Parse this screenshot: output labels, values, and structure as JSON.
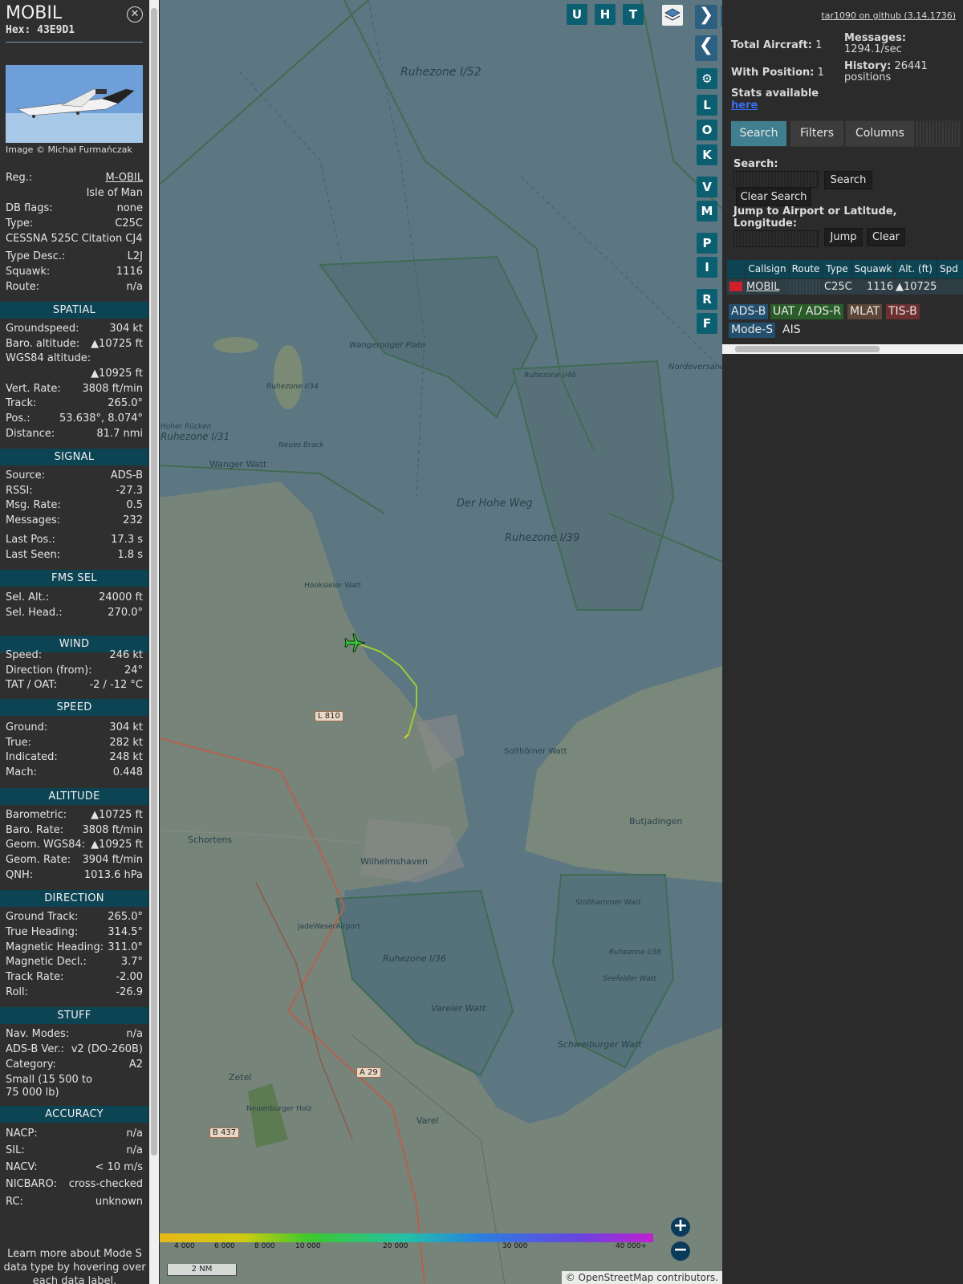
{
  "aircraft": {
    "callsign": "MOBIL",
    "hex_label": "Hex:",
    "hex": "43E9D1",
    "image_credit": "Image © Michał Furmańczak"
  },
  "info_rows": [
    {
      "k": "Reg.:",
      "v": "M-OBIL"
    },
    {
      "k": "",
      "v": "Isle of Man"
    },
    {
      "k": "DB flags:",
      "v": "none"
    },
    {
      "k": "Type:",
      "v": "C25C"
    },
    {
      "k": "CESSNA 525C Citation CJ4",
      "v": ""
    },
    {
      "k": "Type Desc.:",
      "v": "L2J"
    },
    {
      "k": "Squawk:",
      "v": "1116"
    },
    {
      "k": "Route:",
      "v": "n/a"
    }
  ],
  "sections": {
    "spatial": {
      "title": "SPATIAL",
      "rows": [
        {
          "k": "Groundspeed:",
          "v": "304 kt"
        },
        {
          "k": "Baro. altitude:",
          "v": "▲10725 ft"
        },
        {
          "k": "WGS84 altitude:",
          "v": ""
        },
        {
          "k": "",
          "v": "▲10925 ft"
        },
        {
          "k": "Vert. Rate:",
          "v": "3808 ft/min"
        },
        {
          "k": "Track:",
          "v": "265.0°"
        },
        {
          "k": "Pos.:",
          "v": "53.638°, 8.074°"
        },
        {
          "k": "Distance:",
          "v": "81.7 nmi"
        }
      ]
    },
    "signal": {
      "title": "SIGNAL",
      "rows": [
        {
          "k": "Source:",
          "v": "ADS-B"
        },
        {
          "k": "RSSI:",
          "v": "-27.3"
        },
        {
          "k": "Msg. Rate:",
          "v": "0.5"
        },
        {
          "k": "Messages:",
          "v": "232"
        },
        {
          "k": "Last Pos.:",
          "v": "17.3 s"
        },
        {
          "k": "Last Seen:",
          "v": "1.8 s"
        }
      ]
    },
    "fms": {
      "title": "FMS SEL",
      "rows": [
        {
          "k": "Sel. Alt.:",
          "v": "24000 ft"
        },
        {
          "k": "Sel. Head.:",
          "v": "270.0°"
        }
      ]
    },
    "wind": {
      "title": "WIND",
      "rows": [
        {
          "k": "Speed:",
          "v": "246 kt"
        },
        {
          "k": "Direction (from):",
          "v": "24°"
        },
        {
          "k": "TAT / OAT:",
          "v": "-2 / -12 °C"
        }
      ]
    },
    "speed": {
      "title": "SPEED",
      "rows": [
        {
          "k": "Ground:",
          "v": "304 kt"
        },
        {
          "k": "True:",
          "v": "282 kt"
        },
        {
          "k": "Indicated:",
          "v": "248 kt"
        },
        {
          "k": "Mach:",
          "v": "0.448"
        }
      ]
    },
    "altitude": {
      "title": "ALTITUDE",
      "rows": [
        {
          "k": "Barometric:",
          "v": "▲10725 ft"
        },
        {
          "k": "Baro. Rate:",
          "v": "3808 ft/min"
        },
        {
          "k": "Geom. WGS84:",
          "v": "▲10925 ft"
        },
        {
          "k": "Geom. Rate:",
          "v": "3904 ft/min"
        },
        {
          "k": "QNH:",
          "v": "1013.6 hPa"
        }
      ]
    },
    "direction": {
      "title": "DIRECTION",
      "rows": [
        {
          "k": "Ground Track:",
          "v": "265.0°"
        },
        {
          "k": "True Heading:",
          "v": "314.5°"
        },
        {
          "k": "Magnetic Heading:",
          "v": "311.0°"
        },
        {
          "k": "Magnetic Decl.:",
          "v": "3.7°"
        },
        {
          "k": "Track Rate:",
          "v": "-2.00"
        },
        {
          "k": "Roll:",
          "v": "-26.9"
        }
      ]
    },
    "stuff": {
      "title": "STUFF",
      "rows": [
        {
          "k": "Nav. Modes:",
          "v": "n/a"
        },
        {
          "k": "ADS-B Ver.:",
          "v": "v2 (DO-260B)"
        },
        {
          "k": "Category:",
          "v": "A2"
        },
        {
          "k": "Small (15 500 to",
          "v": ""
        },
        {
          "k": "75 000 lb)",
          "v": ""
        }
      ]
    },
    "accuracy": {
      "title": "ACCURACY",
      "rows": [
        {
          "k": "NACP:",
          "v": "n/a"
        },
        {
          "k": "SIL:",
          "v": "n/a"
        },
        {
          "k": "NACV:",
          "v": "< 10 m/s"
        },
        {
          "k": "NICBARO:",
          "v": "cross-checked"
        },
        {
          "k": "RC:",
          "v": "unknown"
        }
      ]
    }
  },
  "learn_more": "Learn more about Mode S data type by hovering over each data label.",
  "map": {
    "top_buttons": [
      "U",
      "H",
      "T"
    ],
    "side_buttons": [
      "L",
      "O",
      "K",
      "V",
      "M",
      "P",
      "I",
      "R",
      "F"
    ],
    "labels": [
      "Ruhezone I/52",
      "Wangerooger Plate",
      "Ruhezone I/34",
      "Hoher Rücken",
      "Ruhezone I/31",
      "Neues Brack",
      "Wanger Watt",
      "Der Hohe Weg",
      "Ruhezone I/39",
      "Ruhezone I/46",
      "Nordeversand",
      "Hooksieler Watt",
      "L 810",
      "Solthörner Watt",
      "Butjadingen",
      "Schortens",
      "Wilhelmshaven",
      "JadeWeserAirport",
      "Stollhammer Watt",
      "Ruhezone I/36",
      "Vareler Watt",
      "Ruhezone I/38",
      "Seefelder Watt",
      "Schweiburger Watt",
      "Zetel",
      "Neuenburger Holz",
      "A 29",
      "Varel",
      "B 437"
    ],
    "alt_ticks": [
      "4 000",
      "6 000",
      "8 000",
      "10 000",
      "20 000",
      "30 000",
      "40 000+"
    ],
    "scale": "2 NM",
    "attribution": "© OpenStreetMap contributors."
  },
  "sidebar": {
    "github": "tar1090 on github (3.14.1736)",
    "total_aircraft_label": "Total Aircraft:",
    "total_aircraft": "1",
    "with_position_label": "With Position:",
    "with_position": "1",
    "messages_label": "Messages:",
    "messages_value": "1294.1/sec",
    "history_label": "History:",
    "history_value": "26441",
    "history_unit": "positions",
    "stats_text": "Stats available",
    "stats_link": "here",
    "tabs": [
      "Search",
      "Filters",
      "Columns"
    ],
    "search_label": "Search:",
    "search_button": "Search",
    "clear_search_button": "Clear Search",
    "jump_label": "Jump to Airport or Latitude, Longitude:",
    "jump_button": "Jump",
    "clear_button": "Clear",
    "table_headers": [
      "Callsign",
      "Route",
      "Type",
      "Squawk",
      "Alt. (ft)",
      "Spd"
    ],
    "table_row": {
      "callsign": "MOBIL",
      "route": "",
      "type": "C25C",
      "squawk": "1116",
      "alt": "▲10725"
    },
    "source_tags": [
      "ADS-B",
      "UAT / ADS-R",
      "MLAT",
      "TIS-B",
      "Mode-S",
      "AIS"
    ]
  },
  "colors": {
    "section": "#0d4454",
    "tab_active": "#3f7f8f",
    "tag_adsb": "#234f6e",
    "tag_uat": "#2a5c2a",
    "tag_mlat": "#5b4637",
    "tag_tisb": "#6b3030",
    "tag_modes": "#234f6e"
  }
}
